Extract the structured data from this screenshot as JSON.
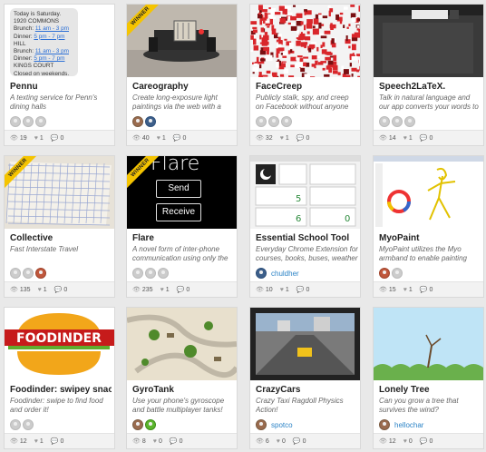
{
  "cards": [
    {
      "id": "pennu",
      "title": "Pennu",
      "desc": "A texting service for Penn's dining halls",
      "views": "19",
      "likes": "1",
      "comments": "0",
      "winner": false,
      "avatars": [
        "gray",
        "gray",
        "gray"
      ],
      "username": ""
    },
    {
      "id": "careography",
      "title": "Careography",
      "desc": "Create long-exposure light paintings via the web with a",
      "views": "40",
      "likes": "1",
      "comments": "0",
      "winner": true,
      "avatars": [
        "photo",
        "photo2"
      ],
      "username": ""
    },
    {
      "id": "facecreep",
      "title": "FaceCreep",
      "desc": "Publicly stalk, spy, and creep on Facebook without anyone",
      "views": "32",
      "likes": "1",
      "comments": "0",
      "winner": false,
      "avatars": [
        "gray",
        "gray",
        "gray"
      ],
      "username": ""
    },
    {
      "id": "speech2latex",
      "title": "Speech2LaTeX.",
      "desc": "Talk in natural language and our app converts your words to LaTeX",
      "views": "14",
      "likes": "1",
      "comments": "0",
      "winner": false,
      "avatars": [
        "gray",
        "gray",
        "gray"
      ],
      "username": ""
    },
    {
      "id": "collective",
      "title": "Collective",
      "desc": "Fast Interstate Travel",
      "views": "135",
      "likes": "1",
      "comments": "0",
      "winner": true,
      "avatars": [
        "gray",
        "gray",
        "photo3"
      ],
      "username": ""
    },
    {
      "id": "flare",
      "title": "Flare",
      "desc": "A novel form of inter-phone communication using only the",
      "views": "235",
      "likes": "1",
      "comments": "0",
      "winner": true,
      "avatars": [
        "gray",
        "gray",
        "gray"
      ],
      "username": ""
    },
    {
      "id": "essential",
      "title": "Essential School Tool",
      "desc": "Everyday Chrome Extension for courses, books, buses, weather",
      "views": "10",
      "likes": "1",
      "comments": "0",
      "winner": false,
      "avatars": [
        "suit"
      ],
      "username": "chuldher"
    },
    {
      "id": "myopaint",
      "title": "MyoPaint",
      "desc": "MyoPaint utilizes the Myo armband to enable painting using",
      "views": "15",
      "likes": "1",
      "comments": "0",
      "winner": false,
      "avatars": [
        "photo3",
        "gray"
      ],
      "username": ""
    },
    {
      "id": "foodinder",
      "title": "Foodinder: swipey snacks!",
      "desc": "Foodinder: swipe to find food and order it!",
      "views": "12",
      "likes": "1",
      "comments": "0",
      "winner": false,
      "avatars": [
        "gray",
        "gray"
      ],
      "username": ""
    },
    {
      "id": "gyrotank",
      "title": "GyroTank",
      "desc": "Use your phone's gyroscope and battle multiplayer tanks!",
      "views": "8",
      "likes": "0",
      "comments": "0",
      "winner": false,
      "avatars": [
        "photo",
        "frog"
      ],
      "username": ""
    },
    {
      "id": "crazycars",
      "title": "CrazyCars",
      "desc": "Crazy Taxi Ragdoll Physics Action!",
      "views": "6",
      "likes": "0",
      "comments": "0",
      "winner": false,
      "avatars": [
        "bird"
      ],
      "username": "spotco"
    },
    {
      "id": "lonelytree",
      "title": "Lonely Tree",
      "desc": "Can you grow a tree that survives the wind?",
      "views": "12",
      "likes": "0",
      "comments": "0",
      "winner": false,
      "avatars": [
        "photo"
      ],
      "username": "hellochar"
    }
  ],
  "pennu_thumb": {
    "lines": [
      "Today is Saturday.",
      "1920 COMMONS"
    ],
    "brunch_label": "Brunch:",
    "brunch_time": "11 am - 3 pm",
    "dinner_label": "Dinner:",
    "dinner_time": "5 pm - 7 pm",
    "hill": "HILL",
    "kings": "KINGS COURT",
    "closed": "Closed on weekends."
  },
  "flare_thumb": {
    "heading": "Flare",
    "send": "Send",
    "receive": "Receive"
  },
  "foodinder_thumb": {
    "logo": "FOODINDER"
  },
  "winner_label": "WINNER",
  "icons": {
    "view": "eye-icon",
    "like": "like-icon",
    "comment": "comment-icon"
  }
}
